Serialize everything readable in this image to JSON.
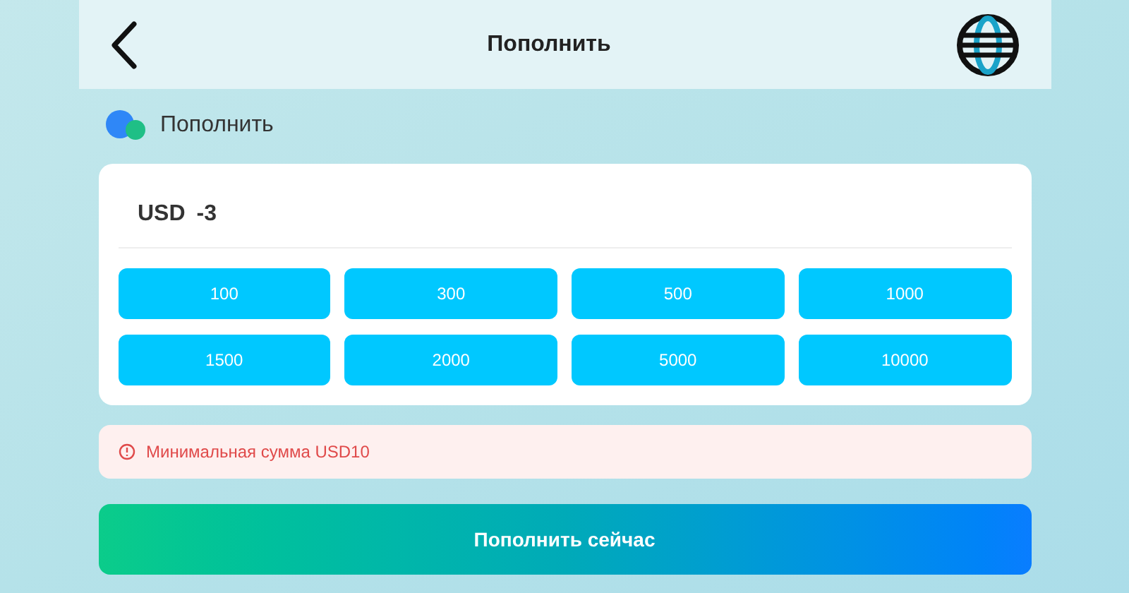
{
  "header": {
    "title": "Пополнить"
  },
  "section": {
    "title": "Пополнить"
  },
  "amount_field": {
    "currency": "USD",
    "value": "-3"
  },
  "presets": [
    {
      "label": "100"
    },
    {
      "label": "300"
    },
    {
      "label": "500"
    },
    {
      "label": "1000"
    },
    {
      "label": "1500"
    },
    {
      "label": "2000"
    },
    {
      "label": "5000"
    },
    {
      "label": "10000"
    }
  ],
  "error": {
    "message": "Минимальная сумма USD10"
  },
  "submit": {
    "label": "Пополнить сейчас"
  }
}
